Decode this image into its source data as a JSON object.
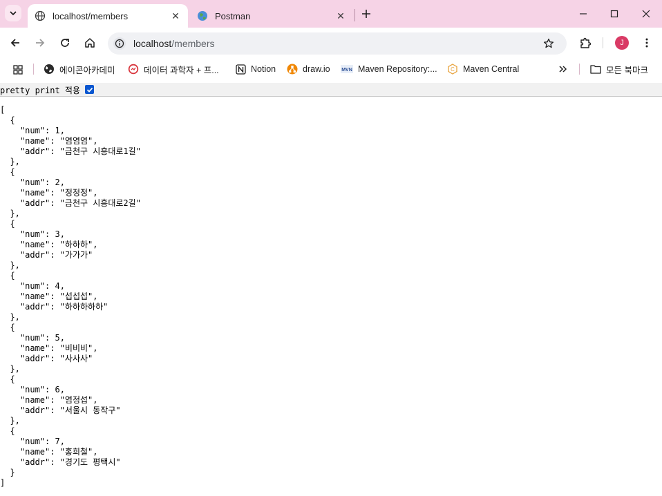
{
  "tabs": [
    {
      "title": "localhost/members",
      "active": true
    },
    {
      "title": "Postman",
      "active": false
    }
  ],
  "address": {
    "host": "localhost",
    "path": "/members"
  },
  "profile": {
    "initial": "J"
  },
  "bookmarks": [
    "에이콘아카데미",
    "데이터 과학자 + 프...",
    "Notion",
    "draw.io",
    "Maven Repository:...",
    "Maven Central"
  ],
  "all_bookmarks_label": "모든 북마크",
  "pretty_print": {
    "label": "pretty print 적용",
    "checked": true
  },
  "json_text": "[\n  {\n    \"num\": 1,\n    \"name\": \"염염염\",\n    \"addr\": \"금천구 시흥대로1길\"\n  },\n  {\n    \"num\": 2,\n    \"name\": \"정정정\",\n    \"addr\": \"금천구 시흥대로2길\"\n  },\n  {\n    \"num\": 3,\n    \"name\": \"하하하\",\n    \"addr\": \"가가가\"\n  },\n  {\n    \"num\": 4,\n    \"name\": \"섭섭섭\",\n    \"addr\": \"하하하하하\"\n  },\n  {\n    \"num\": 5,\n    \"name\": \"비비비\",\n    \"addr\": \"사사사\"\n  },\n  {\n    \"num\": 6,\n    \"name\": \"염정섭\",\n    \"addr\": \"서울시 동작구\"\n  },\n  {\n    \"num\": 7,\n    \"name\": \"홍희철\",\n    \"addr\": \"경기도 평택시\"\n  }\n]",
  "colors": {
    "tabstrip": "#f6d3e6",
    "accent": "#0b57d0",
    "avatar": "#d93a65"
  }
}
